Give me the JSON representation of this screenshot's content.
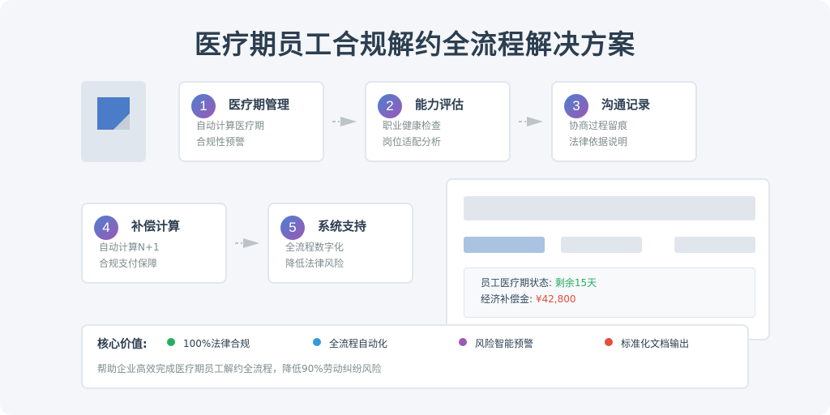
{
  "title": "医疗期员工合规解约全流程解决方案",
  "steps": [
    {
      "number": "1",
      "title": "医疗期管理",
      "lines": [
        "自动计算医疗期",
        "合规性预警"
      ]
    },
    {
      "number": "2",
      "title": "能力评估",
      "lines": [
        "职业健康检查",
        "岗位适配分析"
      ]
    },
    {
      "number": "3",
      "title": "沟通记录",
      "lines": [
        "协商过程留痕",
        "法律依据说明"
      ]
    },
    {
      "number": "4",
      "title": "补偿计算",
      "lines": [
        "自动计算N+1",
        "合规支付保障"
      ]
    },
    {
      "number": "5",
      "title": "系统支持",
      "lines": [
        "全流程数字化",
        "降低法律风险"
      ]
    }
  ],
  "panel": {
    "status_label": "员工医疗期状态: ",
    "status_value": "剩余15天",
    "comp_label": "经济补偿金: ",
    "comp_value": "¥42,800"
  },
  "footer": {
    "core_label": "核心价值:",
    "values": [
      {
        "label": "100%法律合规",
        "color": "#27ae60"
      },
      {
        "label": "全流程自动化",
        "color": "#3498db"
      },
      {
        "label": "风险智能预警",
        "color": "#9b59b6"
      },
      {
        "label": "标准化文档输出",
        "color": "#e74c3c"
      }
    ],
    "description": "帮助企业高效完成医疗期员工解约全流程，降低90%劳动纠纷风险"
  },
  "colors": {
    "status_green": "#27ae60",
    "amount_red": "#e74c3c",
    "badge_start": "#4d7fd0",
    "badge_end": "#9b59b6"
  },
  "icons": [
    "document-icon",
    "arrow-right-icon"
  ]
}
